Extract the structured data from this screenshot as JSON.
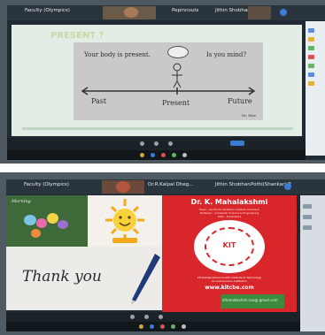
{
  "top_meeting": {
    "toolbar_labels": [
      "Faculty (Olympics)",
      "Pepinnouts",
      "Jithin Shobhan"
    ],
    "slide": {
      "heading": "PRESENT ?",
      "left_phrase": "Your body is present.",
      "right_phrase": "Is you mind?",
      "timeline": [
        "Past",
        "Present",
        "Future"
      ],
      "credit": "Dr. Mee"
    }
  },
  "bottom_meeting": {
    "toolbar_labels": [
      "Faculty (Olympics)",
      "Dr.R.Kalpal Dheg...",
      "Jithin Shobhan",
      "Pothi(Shankar) P"
    ],
    "tile_caption": "Morning",
    "thank_you": "Thank you",
    "card": {
      "name": "Dr. K. Mahalakshmi",
      "line1": "Dean - Centre for Robotics Institute Outreach",
      "line2": "Professor - Computer Science & Engineering",
      "line3": "Kalvi - Koinbatore",
      "emblem": "KIT",
      "college": "KIT-Kalaignarkarunanidhi Institute of Technology",
      "place": "An Autonomous Institution",
      "website": "www.kitcbe.com",
      "email": "drkmalakshmi.cse@ gmail.com"
    }
  }
}
